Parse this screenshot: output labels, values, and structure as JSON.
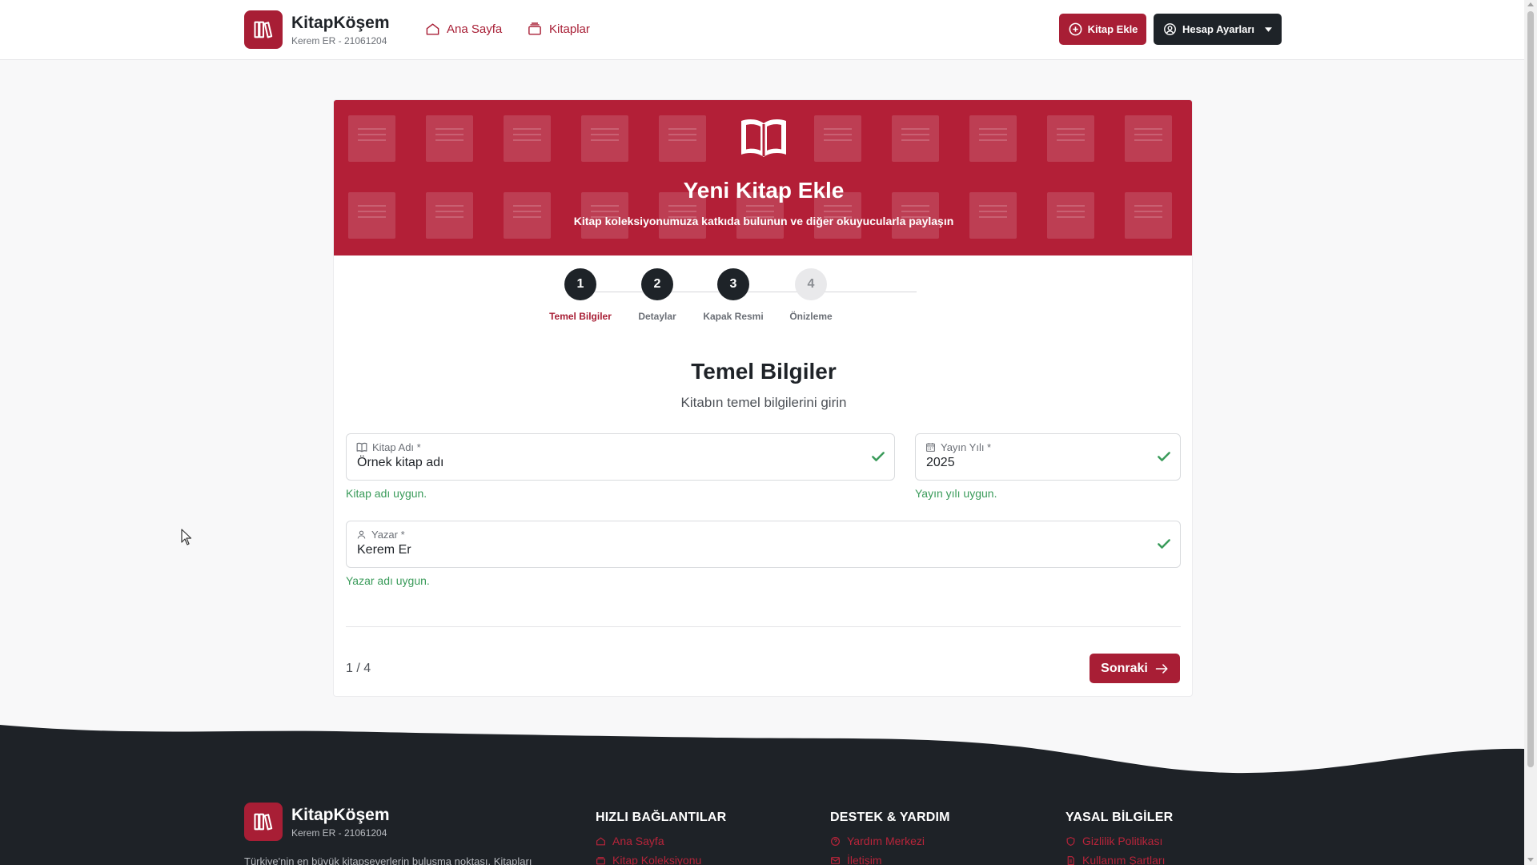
{
  "brand": {
    "name": "KitapKöşem",
    "sub": "Kerem ER - 21061204"
  },
  "nav": {
    "home": "Ana Sayfa",
    "books": "Kitaplar"
  },
  "actions": {
    "add_book": "Kitap Ekle",
    "account": "Hesap Ayarları"
  },
  "hero": {
    "title": "Yeni Kitap Ekle",
    "subtitle": "Kitap koleksiyonumuza katkıda bulunun ve diğer okuyucularla paylaşın"
  },
  "steps": [
    {
      "number": "1",
      "label": "Temel Bilgiler",
      "state": "active"
    },
    {
      "number": "2",
      "label": "Detaylar",
      "state": "pending"
    },
    {
      "number": "3",
      "label": "Kapak Resmi",
      "state": "pending"
    },
    {
      "number": "4",
      "label": "Önizleme",
      "state": "disabled"
    }
  ],
  "form": {
    "title": "Temel Bilgiler",
    "subtitle": "Kitabın temel bilgilerini girin",
    "title_field": {
      "label": "Kitap Adı *",
      "value": "Örnek kitap adı",
      "message": "Kitap adı uygun."
    },
    "year_field": {
      "label": "Yayın Yılı *",
      "value": "2025",
      "message": "Yayın yılı uygun."
    },
    "author_field": {
      "label": "Yazar *",
      "value": "Kerem Er",
      "message": "Yazar adı uygun."
    },
    "page_count": "1 / 4",
    "next_label": "Sonraki"
  },
  "footer": {
    "brand_name": "KitapKöşem",
    "brand_sub": "Kerem ER - 21061204",
    "description": "Türkiye'nin en büyük kitapseverlerin buluşma noktası. Kitapları",
    "columns": [
      {
        "title": "HIZLI BAĞLANTILAR",
        "links": [
          "Ana Sayfa",
          "Kitap Koleksiyonu"
        ]
      },
      {
        "title": "DESTEK & YARDIM",
        "links": [
          "Yardım Merkezi",
          "İletişim"
        ]
      },
      {
        "title": "YASAL BİLGİLER",
        "links": [
          "Gizlilik Politikası",
          "Kullanım Şartları"
        ]
      }
    ]
  },
  "colors": {
    "accent": "#a81e35",
    "dark": "#1e2328",
    "success": "#3a9b5a",
    "footer_bg": "#1e2227"
  }
}
